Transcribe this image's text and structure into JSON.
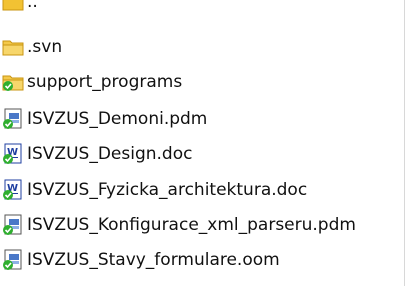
{
  "files": [
    {
      "name": "..",
      "icon": "folder-up-icon"
    },
    {
      "name": ".svn",
      "icon": "folder-icon"
    },
    {
      "name": "support_programs",
      "icon": "shared-folder-icon"
    },
    {
      "name": "ISVZUS_Demoni.pdm",
      "icon": "pdm-file-icon"
    },
    {
      "name": "ISVZUS_Design.doc",
      "icon": "word-doc-icon"
    },
    {
      "name": "ISVZUS_Fyzicka_architektura.doc",
      "icon": "word-doc-icon"
    },
    {
      "name": "ISVZUS_Konfigurace_xml_parseru.pdm",
      "icon": "pdm-file-icon"
    },
    {
      "name": "ISVZUS_Stavy_formulare.oom",
      "icon": "oom-file-icon"
    }
  ],
  "colors": {
    "folder": "#f2c233",
    "folder_dark": "#c99512",
    "svn_check": "#2fae2f",
    "doc_blue": "#1f3fa0"
  }
}
